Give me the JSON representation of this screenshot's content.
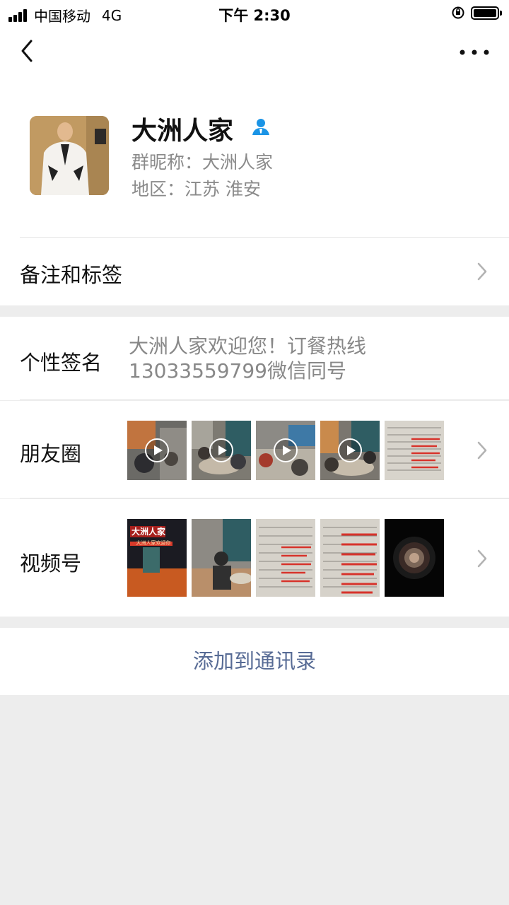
{
  "status_bar": {
    "carrier": "中国移动",
    "network": "4G",
    "time": "下午 2:30"
  },
  "nav": {
    "back_icon": "chevron-left-icon",
    "more_icon": "more-dots-icon"
  },
  "profile": {
    "name": "大洲人家",
    "group_nickname": "群昵称：大洲人家",
    "region": "地区：江苏 淮安",
    "verified_icon": "person-icon",
    "accent_color": "#1a94e6"
  },
  "remarks": {
    "label": "备注和标签"
  },
  "signature": {
    "label": "个性签名",
    "text": "大洲人家欢迎您！订餐热线13033559799微信同号"
  },
  "moments": {
    "label": "朋友圈",
    "items": [
      {
        "type": "video"
      },
      {
        "type": "video"
      },
      {
        "type": "video"
      },
      {
        "type": "video"
      },
      {
        "type": "image"
      }
    ]
  },
  "channels": {
    "label": "视频号",
    "storefront_text": "大洲人家",
    "storefront_subtext": "大洲人家欢迎你",
    "items": [
      {
        "type": "storefront"
      },
      {
        "type": "restaurant"
      },
      {
        "type": "menu"
      },
      {
        "type": "menu"
      },
      {
        "type": "lens"
      }
    ]
  },
  "actions": {
    "add_to_contacts": "添加到通讯录",
    "link_color": "#576b95"
  }
}
